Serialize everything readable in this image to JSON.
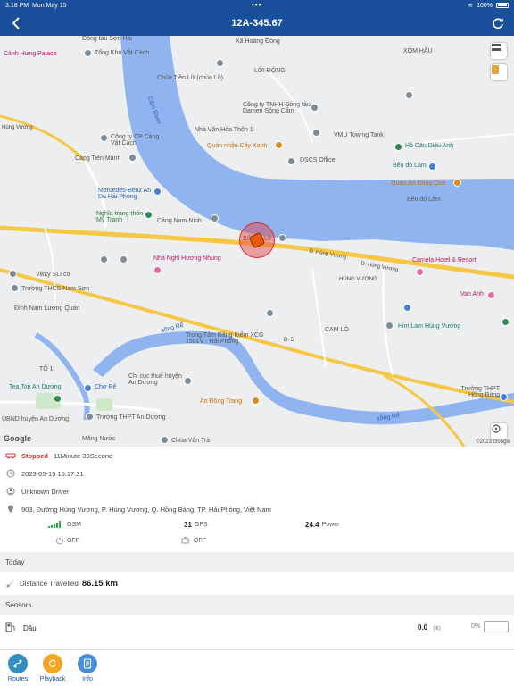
{
  "status_bar": {
    "time": "3:18 PM",
    "date": "Mon May 15",
    "battery": "100%"
  },
  "nav": {
    "title": "12A-345.67"
  },
  "map": {
    "labels": {
      "dong_tau_son_hai": "Đồng tàu Sơn Hải",
      "canh_hung_palace": "Cảnh Hưng Palace",
      "tong_kho_vat_cach": "Tổng Kho Vật Cách",
      "xa_hoang_dong": "Xã Hoàng Đồng",
      "loi_dong": "LỜI ĐỘNG",
      "xom_hau": "XÓM HẬU",
      "chua_tien_lu": "Chùa Tiền Lữ (chùa Lồ)",
      "cam_river": "Cấm River",
      "hung_vuong_left": "Hùng Vương",
      "cong_ty_cp": "Công ty CP Cảng Vật Cách",
      "cong_ty_tnhh": "Công ty TNHH Đóng tàu Damen Sông Cấm",
      "nha_van_hoa": "Nhà Văn Hóa Thôn 1",
      "vmu_towing": "VMU Towing Tank",
      "ho_cau": "Hồ Câu Diệu Anh",
      "quan_nhau": "Quán nhậu Cây Xanh",
      "dscs": "DSCS Office",
      "cang_tien_manh": "Cảng Tiền Mạnh",
      "ben_do_lam_top": "Bến đò Lâm",
      "quan_an_dong_que": "Quán Ăn Đồng Quê",
      "mercedes": "Mercedes-Benz An Du Hải Phòng",
      "ben_do_lam": "Bến đò Lâm",
      "nghia_trang": "Nghĩa trang thôn Mỹ Tranh",
      "cang_nam_ninh": "Cảng Nam Ninh",
      "ben_do_lo": "Bến đò Lồ",
      "d_hung_vuong": "D. Hùng Vương",
      "d_hung_vuong2": "D. Hùng Vương",
      "nha_nghi": "Nhà Nghỉ Hương Nhung",
      "camela": "Camela Hotel & Resort",
      "vikky": "Vikky SLI co",
      "truong_thcs": "Trường THCS Nam Sơn",
      "hung_vuong_small": "HÙNG VƯƠNG",
      "van_anh": "Van Anh",
      "dinh_nam": "Đình Nam Lương Quán",
      "cam_lo": "CAM LỘ",
      "him_lam": "Him Lam Hùng Vương",
      "song_re_top": "sông Rế",
      "trung_tam": "Trung Tâm Đăng Kiểm XCG 1501V - Hải Phòng",
      "d5": "D. 5",
      "to1": "TỔ 1",
      "chi_cuc": "Chi cục thuế huyện An Dương",
      "tea_top": "Tea Top An Dương",
      "cho_re": "Chợ Rế",
      "an_dong_trang": "An Động Trang",
      "truong_thpt_hb": "Trường THPT Hồng Bàng",
      "ubnd": "UBND huyện An Dương",
      "truong_thpt_ad": "Trường THPT An Dương",
      "song_re_bottom": "sông Rế",
      "mang_nuoc": "Măng Nước",
      "chua_van_tra": "Chùa Văn Trà",
      "google": "Google",
      "copyright": "©2023 Google"
    }
  },
  "vehicle": {
    "status_label": "Stopped",
    "duration": "11Minute 39Second",
    "timestamp": "2023-05-15 15:17:31",
    "driver": "Unknown Driver",
    "address": "903, Đường Hùng Vương, P. Hùng Vương, Q. Hồng Bàng, TP. Hải Phòng, Việt Nam",
    "gsm_label": "GSM",
    "gps_value": "31",
    "gps_label": "GPS",
    "power_value": "24.4",
    "power_label": "Power",
    "ignition_state": "OFF",
    "engine_state": "OFF"
  },
  "today": {
    "header": "Today",
    "distance_label": "Distance Travelled",
    "distance_value": "86.15 km"
  },
  "sensors": {
    "header": "Sensors",
    "name": "Dầu",
    "value": "0.0",
    "unit": "(lit)",
    "percent": "0%"
  },
  "tabs": {
    "routes": "Routes",
    "playback": "Playback",
    "info": "Info"
  },
  "colors": {
    "accent": "#1a4f9c",
    "stopped": "#d32f2f"
  }
}
